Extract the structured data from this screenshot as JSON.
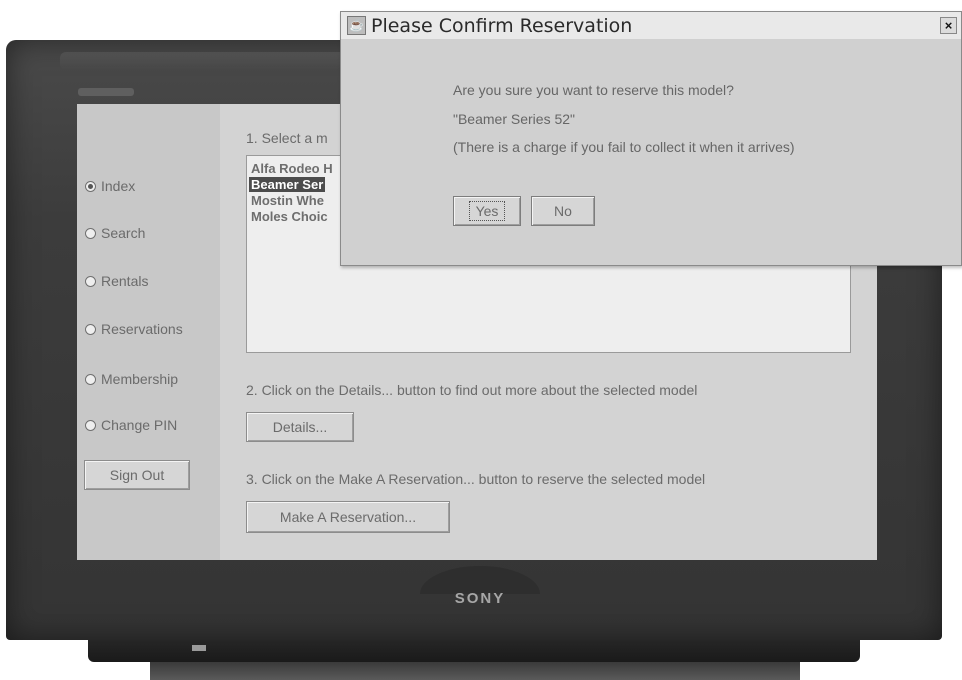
{
  "tv": {
    "brand": "SONY"
  },
  "sidebar": {
    "options": [
      {
        "label": "Index",
        "selected": true
      },
      {
        "label": "Search",
        "selected": false
      },
      {
        "label": "Rentals",
        "selected": false
      },
      {
        "label": "Reservations",
        "selected": false
      },
      {
        "label": "Membership",
        "selected": false
      },
      {
        "label": "Change PIN",
        "selected": false
      }
    ],
    "sign_out_label": "Sign Out"
  },
  "main": {
    "step1_label": "1. Select a m",
    "models": [
      {
        "label": "Alfa Rodeo H",
        "selected": false
      },
      {
        "label": "Beamer Ser",
        "selected": true
      },
      {
        "label": "Mostin Whe",
        "selected": false
      },
      {
        "label": "Moles Choic",
        "selected": false
      }
    ],
    "step2_label": "2. Click on the Details... button to find out more about the selected model",
    "details_button": "Details...",
    "step3_label": "3. Click on the Make A Reservation... button to reserve the selected model",
    "reserve_button": "Make A Reservation..."
  },
  "dialog": {
    "title": "Please Confirm Reservation",
    "close_label": "×",
    "icon": "java-cup-icon",
    "lines": [
      "Are you sure you want to reserve this model?",
      "\"Beamer Series 52\"",
      "(There is a charge if you fail to collect it when it arrives)"
    ],
    "yes_label": "Yes",
    "no_label": "No"
  }
}
